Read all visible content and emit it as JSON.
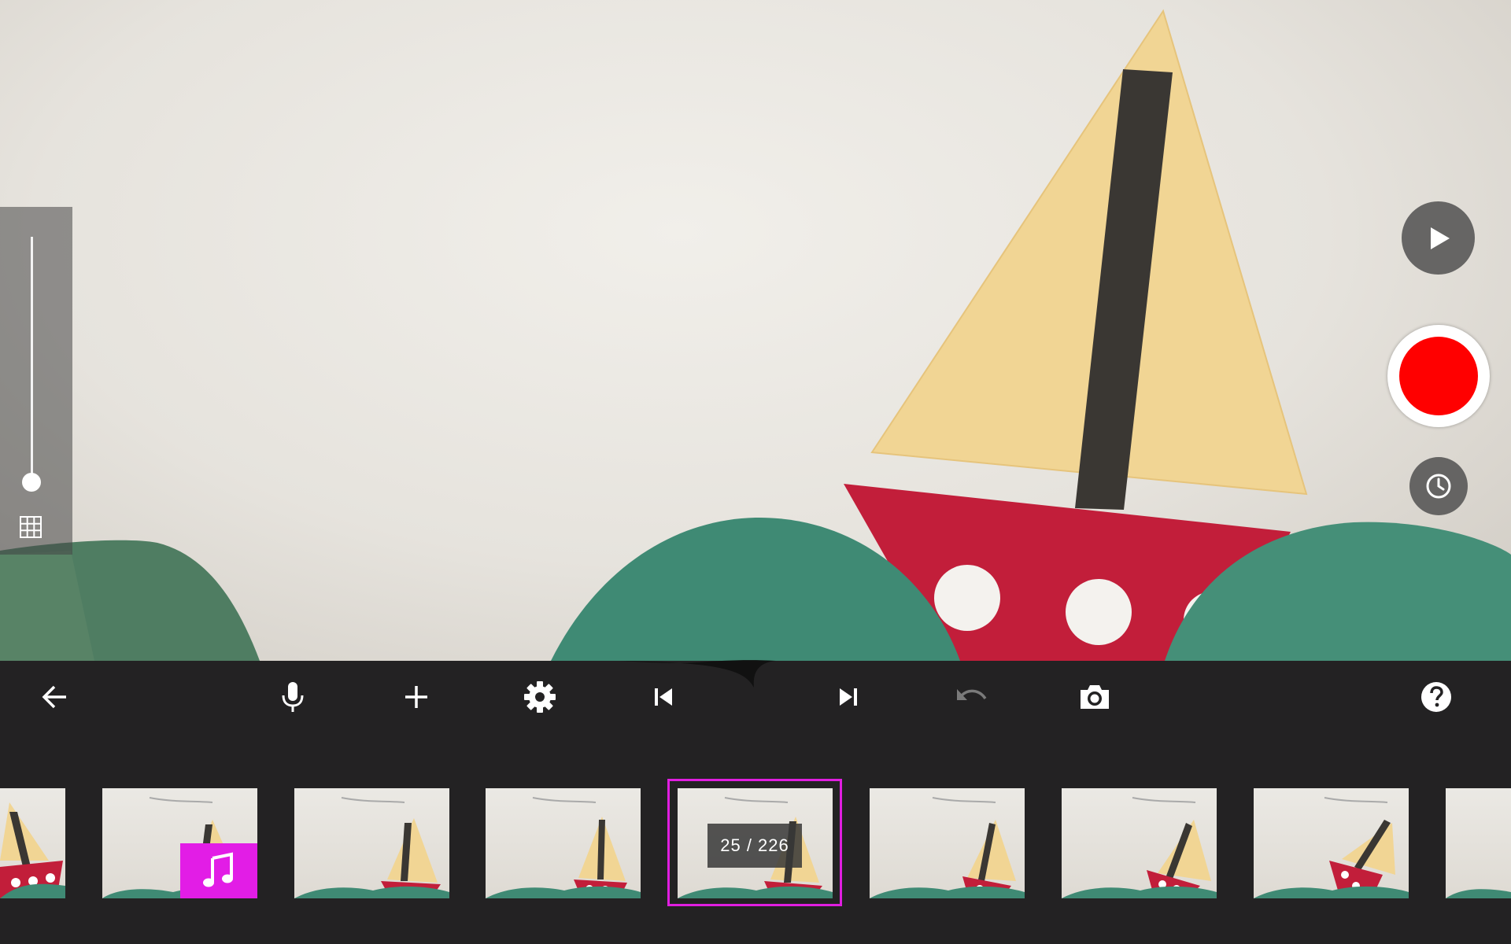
{
  "colors": {
    "accent": "#e01ee0",
    "record": "#ff0000",
    "toolbar_bg": "#232223",
    "sail": "#f1d594",
    "hull": "#c21e3a",
    "waves": "#3f8a74"
  },
  "left_panel": {
    "slider_level": 0.0,
    "grid_icon": "grid-icon"
  },
  "right_controls": {
    "play_icon": "play-icon",
    "record_icon": "record-icon",
    "timer_icon": "timer-icon"
  },
  "toolbar": {
    "items": [
      {
        "name": "back-button",
        "icon": "arrow-left-icon",
        "enabled": true
      },
      {
        "name": "microphone-button",
        "icon": "microphone-icon",
        "enabled": true
      },
      {
        "name": "add-button",
        "icon": "plus-icon",
        "enabled": true
      },
      {
        "name": "settings-button",
        "icon": "gear-icon",
        "enabled": true
      },
      {
        "name": "skip-to-start-button",
        "icon": "skip-start-icon",
        "enabled": true
      },
      {
        "name": "skip-to-end-button",
        "icon": "skip-end-icon",
        "enabled": true
      },
      {
        "name": "undo-button",
        "icon": "undo-icon",
        "enabled": false
      },
      {
        "name": "camera-button",
        "icon": "camera-icon",
        "enabled": true
      },
      {
        "name": "help-button",
        "icon": "help-icon",
        "enabled": true
      }
    ]
  },
  "filmstrip": {
    "frame_counter": "25 / 226",
    "selected_index": 4,
    "audio_badge_icon": "music-note-icon"
  }
}
